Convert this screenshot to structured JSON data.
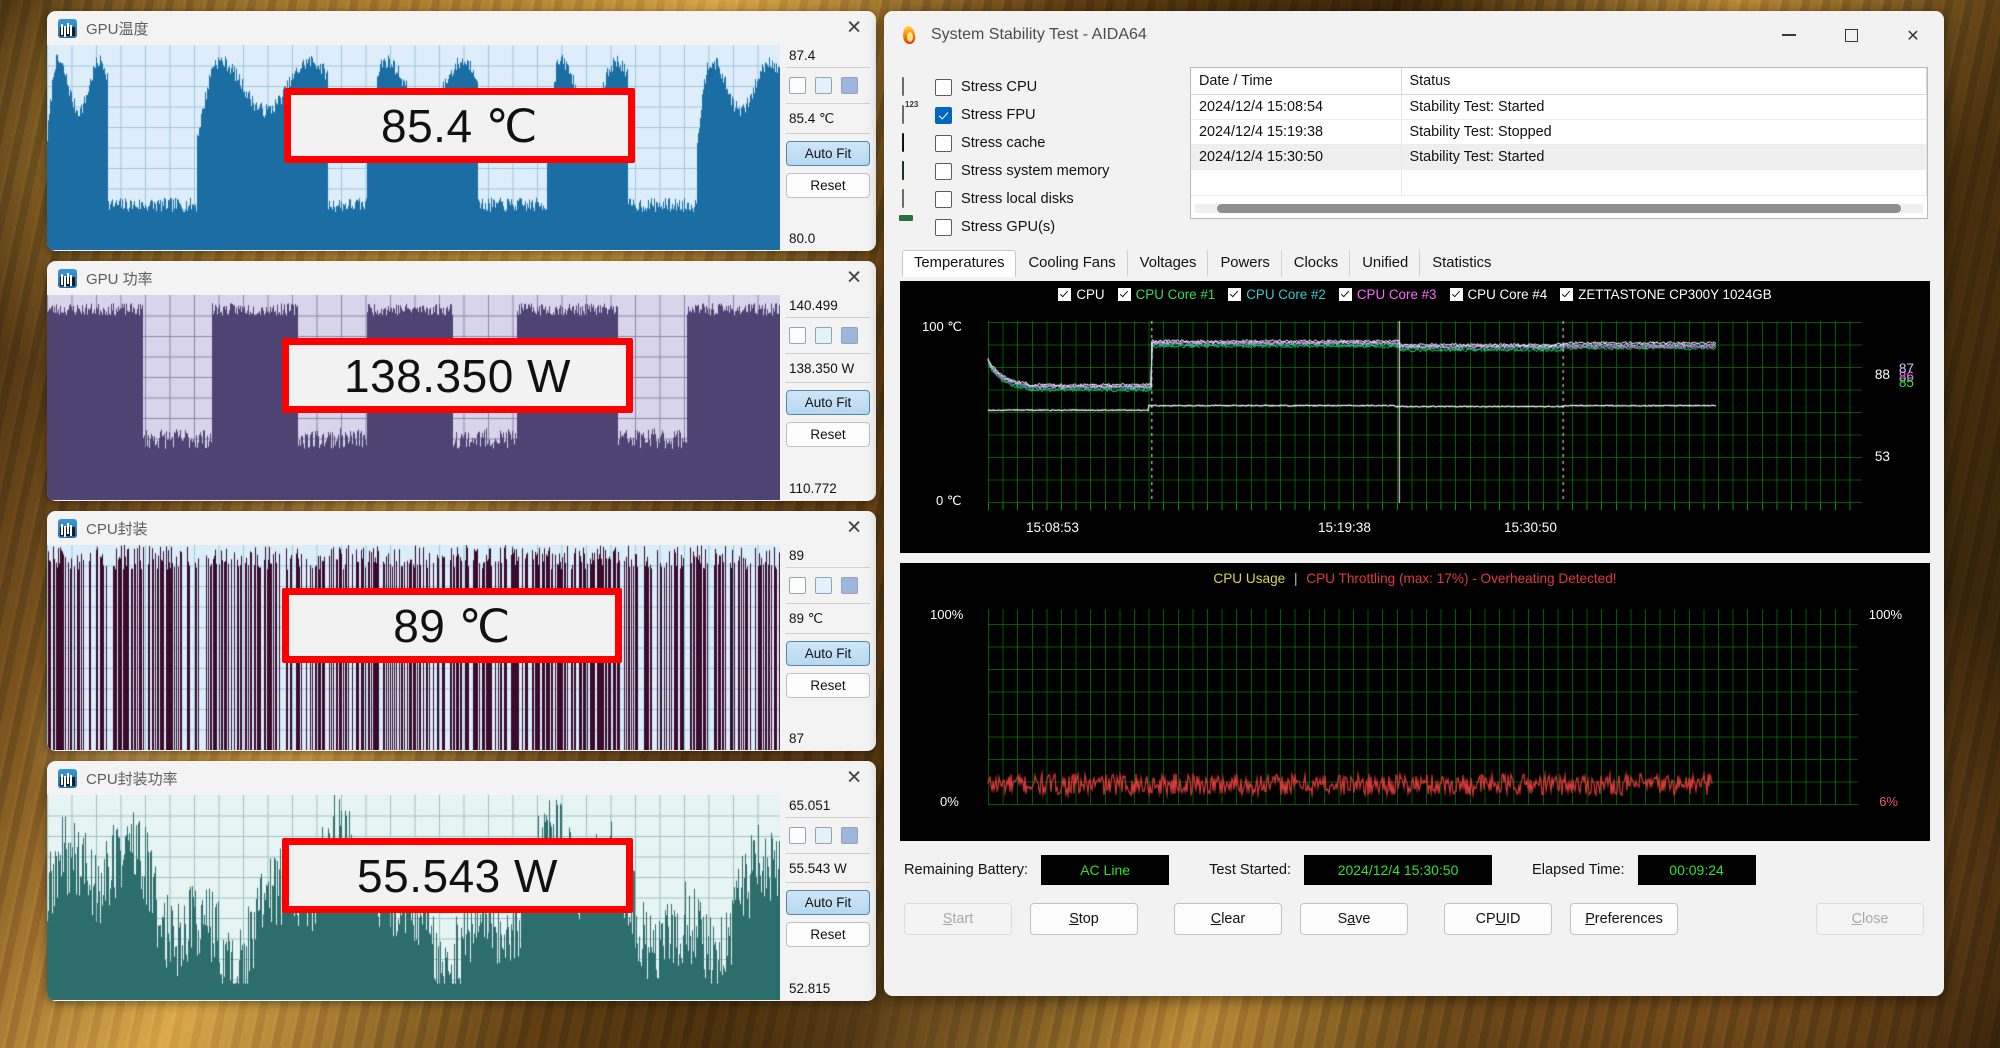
{
  "sensor_panels": [
    {
      "title": "GPU温度",
      "max_label": "87.4",
      "current_label": "85.4 ℃",
      "min_label": "80.0",
      "callout": "85.4 ℃",
      "auto_fit_label": "Auto Fit",
      "reset_label": "Reset",
      "close_label": "✕",
      "graph_color": "#1f6ea0",
      "graph_bg": "#ddeefa"
    },
    {
      "title": "GPU 功率",
      "max_label": "140.499",
      "current_label": "138.350 W",
      "min_label": "110.772",
      "callout": "138.350 W",
      "auto_fit_label": "Auto Fit",
      "reset_label": "Reset",
      "close_label": "✕",
      "graph_color": "#6e6699",
      "graph_bg": "#d8d4ea"
    },
    {
      "title": "CPU封装",
      "max_label": "89",
      "current_label": "89 ℃",
      "min_label": "87",
      "callout": "89 ℃",
      "auto_fit_label": "Auto Fit",
      "reset_label": "Reset",
      "close_label": "✕",
      "graph_color": "#3a0a2a",
      "graph_bg": "#dceefa"
    },
    {
      "title": "CPU封装功率",
      "max_label": "65.051",
      "current_label": "55.543 W",
      "min_label": "52.815",
      "callout": "55.543 W",
      "auto_fit_label": "Auto Fit",
      "reset_label": "Reset",
      "close_label": "✕",
      "graph_color": "#2c6e6b",
      "graph_bg": "#e7f4f4"
    }
  ],
  "aida": {
    "window_title": "System Stability Test - AIDA64",
    "titlebar_icon": "flame-icon",
    "minimize_label": "—",
    "maximize_label": "□",
    "close_label": "✕",
    "stress_options": [
      {
        "label": "Stress CPU",
        "checked": false,
        "icon": "cpu-chip-icon"
      },
      {
        "label": "Stress FPU",
        "checked": true,
        "icon": "fpu-chip-icon"
      },
      {
        "label": "Stress cache",
        "checked": false,
        "icon": "cache-chip-icon"
      },
      {
        "label": "Stress system memory",
        "checked": false,
        "icon": "memory-module-icon"
      },
      {
        "label": "Stress local disks",
        "checked": false,
        "icon": "hard-disk-icon"
      },
      {
        "label": "Stress GPU(s)",
        "checked": false,
        "icon": "graphics-card-icon"
      }
    ],
    "log": {
      "columns": [
        "Date / Time",
        "Status"
      ],
      "rows": [
        {
          "datetime": "2024/12/4 15:08:54",
          "status": "Stability Test: Started",
          "selected": false
        },
        {
          "datetime": "2024/12/4 15:19:38",
          "status": "Stability Test: Stopped",
          "selected": false
        },
        {
          "datetime": "2024/12/4 15:30:50",
          "status": "Stability Test: Started",
          "selected": true
        }
      ]
    },
    "tabs": [
      {
        "label": "Temperatures",
        "active": true
      },
      {
        "label": "Cooling Fans",
        "active": false
      },
      {
        "label": "Voltages",
        "active": false
      },
      {
        "label": "Powers",
        "active": false
      },
      {
        "label": "Clocks",
        "active": false
      },
      {
        "label": "Unified",
        "active": false
      },
      {
        "label": "Statistics",
        "active": false
      }
    ],
    "status": {
      "battery_label": "Remaining Battery:",
      "battery_value": "AC Line",
      "started_label": "Test Started:",
      "started_value": "2024/12/4 15:30:50",
      "elapsed_label": "Elapsed Time:",
      "elapsed_value": "00:09:24",
      "value_color": "#2ee22e"
    },
    "buttons": [
      {
        "id": "start",
        "pre": "",
        "acc": "S",
        "post": "tart",
        "disabled": true
      },
      {
        "id": "stop",
        "pre": "",
        "acc": "S",
        "post": "top",
        "disabled": false
      },
      {
        "id": "clear",
        "pre": "",
        "acc": "C",
        "post": "lear",
        "disabled": false
      },
      {
        "id": "save",
        "pre": "S",
        "acc": "a",
        "post": "ve",
        "disabled": false
      },
      {
        "id": "cpuid",
        "pre": "CP",
        "acc": "U",
        "post": "ID",
        "disabled": false
      },
      {
        "id": "preferences",
        "pre": "",
        "acc": "P",
        "post": "references",
        "disabled": false
      },
      {
        "id": "close",
        "pre": "",
        "acc": "C",
        "post": "lose",
        "disabled": true
      }
    ]
  },
  "chart_data": [
    {
      "type": "line",
      "name": "temperatures",
      "title": "",
      "ylabel_top": "100 ℃",
      "ylabel_bottom": "0 ℃",
      "ylim": [
        0,
        100
      ],
      "grid": true,
      "bg": "#000000",
      "grid_color": "#00a000",
      "legend_position": "top-center",
      "xtick_labels": [
        "15:08:53",
        "15:19:38",
        "15:30:50"
      ],
      "right_value_labels": [
        {
          "text": "88",
          "color": "#ffffff",
          "value": 88
        },
        {
          "text": "87",
          "color": "#c8c8ff",
          "value": 87
        },
        {
          "text": "86",
          "color": "#ff66ff",
          "value": 86
        },
        {
          "text": "85",
          "color": "#33dd55",
          "value": 85
        },
        {
          "text": "53",
          "color": "#ffffff",
          "value": 53
        }
      ],
      "series": [
        {
          "name": "CPU",
          "color": "#ffffff",
          "checked": true,
          "final": 88
        },
        {
          "name": "CPU Core #1",
          "color": "#33dd55",
          "checked": true,
          "final": 85
        },
        {
          "name": "CPU Core #2",
          "color": "#33cccc",
          "checked": true,
          "final": 86
        },
        {
          "name": "CPU Core #3",
          "color": "#ff66ff",
          "checked": true,
          "final": 86
        },
        {
          "name": "CPU Core #4",
          "color": "#ffffff",
          "checked": true,
          "final": 87
        },
        {
          "name": "ZETTASTONE CP300Y 1024GB",
          "color": "#ffffff",
          "checked": true,
          "final": 53
        }
      ]
    },
    {
      "type": "line",
      "name": "cpu-usage",
      "title_main": "CPU Usage",
      "title_sep": "|",
      "title_warning": "CPU Throttling (max: 17%) - Overheating Detected!",
      "title_main_color": "#d8d84a",
      "title_warning_color": "#e03a3a",
      "ylabel_top_left": "100%",
      "ylabel_bottom_left": "0%",
      "ylabel_top_right": "100%",
      "ylabel_bottom_right": "6%",
      "ylim": [
        0,
        100
      ],
      "grid": true,
      "bg": "#000000",
      "grid_color": "#00a000",
      "series": [
        {
          "name": "CPU Throttling",
          "color": "#d83a3a",
          "current": 6
        }
      ]
    }
  ]
}
